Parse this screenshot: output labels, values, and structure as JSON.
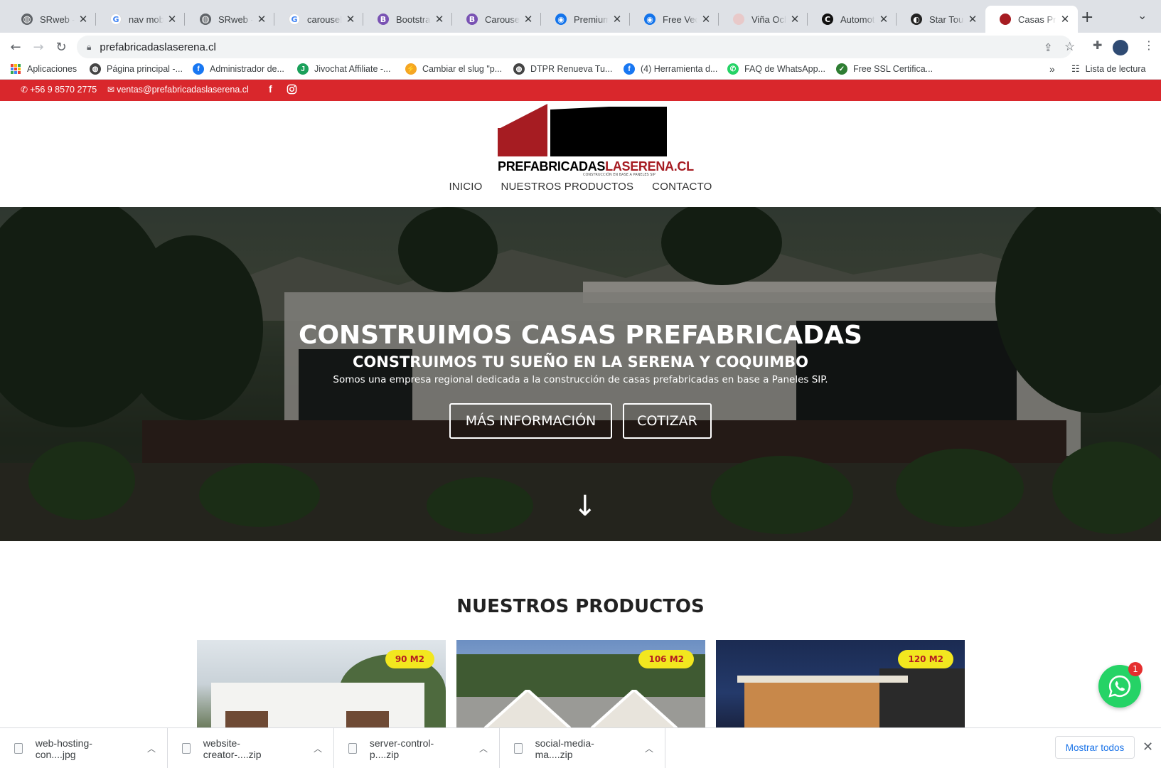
{
  "browser": {
    "tabs": [
      {
        "title": "SRweb - D",
        "favicon": "globe-icon",
        "color": "#5f6368",
        "glyph": ""
      },
      {
        "title": "nav mobile",
        "favicon": "google-icon",
        "color": "#ffffff",
        "glyph": "G"
      },
      {
        "title": "SRweb - D",
        "favicon": "globe-icon",
        "color": "#5f6368",
        "glyph": ""
      },
      {
        "title": "carousel lo",
        "favicon": "google-icon",
        "color": "#ffffff",
        "glyph": "G"
      },
      {
        "title": "Bootstrap",
        "favicon": "bootstrap-icon",
        "color": "#7952b3",
        "glyph": "B"
      },
      {
        "title": "Carousel -",
        "favicon": "bootstrap-icon",
        "color": "#7952b3",
        "glyph": "B"
      },
      {
        "title": "Premium P",
        "favicon": "freepik-icon",
        "color": "#1273eb",
        "glyph": "◉"
      },
      {
        "title": "Free Vecto",
        "favicon": "freepik-icon",
        "color": "#1273eb",
        "glyph": "◉"
      },
      {
        "title": "Viña Ocho",
        "favicon": "vina-icon",
        "color": "#e8c9c9",
        "glyph": ""
      },
      {
        "title": "Automotriz",
        "favicon": "c-icon",
        "color": "#111111",
        "glyph": "C"
      },
      {
        "title": "Star Tour -",
        "favicon": "startour-icon",
        "color": "#222222",
        "glyph": "◐"
      },
      {
        "title": "Casas Pref",
        "favicon": "prefab-icon",
        "color": "#a61c22",
        "glyph": "",
        "active": true
      }
    ],
    "url": "prefabricadaslaserena.cl",
    "bookmarks": [
      {
        "label": "Aplicaciones",
        "icon": "apps-grid-icon"
      },
      {
        "label": "Página principal -...",
        "icon": "globe-icon",
        "color": "#444444"
      },
      {
        "label": "Administrador de...",
        "icon": "facebook-icon",
        "color": "#1877f2",
        "glyph": "f"
      },
      {
        "label": "Jivochat Affiliate -...",
        "icon": "jivochat-icon",
        "color": "#1aa05a",
        "glyph": "J"
      },
      {
        "label": "Cambiar el slug \"p...",
        "icon": "bolt-icon",
        "color": "#f5a623",
        "glyph": "⚡"
      },
      {
        "label": "DTPR Renueva Tu...",
        "icon": "globe-icon",
        "color": "#444444"
      },
      {
        "label": "(4) Herramienta d...",
        "icon": "facebook-icon",
        "color": "#1877f2",
        "glyph": "f"
      },
      {
        "label": "FAQ de WhatsApp...",
        "icon": "whatsapp-icon",
        "color": "#25d366",
        "glyph": "✆"
      },
      {
        "label": "Free SSL Certifica...",
        "icon": "shield-icon",
        "color": "#2e7d32",
        "glyph": "✓"
      }
    ],
    "overflow": "»",
    "reading_list": "Lista de lectura"
  },
  "site": {
    "topbar": {
      "phone": "+56 9 8570 2775",
      "email": "ventas@prefabricadaslaserena.cl",
      "facebook": "f",
      "accent": "#d9272c"
    },
    "logo": {
      "prefix": "PREFABRICADAS",
      "suffix": "LASERENA.CL",
      "tagline": "CONSTRUCCIÓN EN BASE A PANELES SIP"
    },
    "menu": [
      "INICIO",
      "NUESTROS PRODUCTOS",
      "CONTACTO"
    ],
    "hero": {
      "title": "CONSTRUIMOS CASAS PREFABRICADAS",
      "subtitle": "CONSTRUIMOS TU SUEÑO EN LA SERENA Y COQUIMBO",
      "text": "Somos una empresa regional dedicada a la construcción de casas prefabricadas en base a Paneles SIP.",
      "btn_info": "MÁS INFORMACIÓN",
      "btn_quote": "COTIZAR",
      "arrow": "↓"
    },
    "products": {
      "title": "NUESTROS PRODUCTOS",
      "cards": [
        {
          "badge": "90 M2"
        },
        {
          "badge": "106 M2"
        },
        {
          "badge": "120 M2"
        }
      ]
    },
    "whatsapp": {
      "count": "1"
    }
  },
  "downloads": {
    "items": [
      {
        "name": "web-hosting-con....jpg"
      },
      {
        "name": "website-creator-....zip"
      },
      {
        "name": "server-control-p....zip"
      },
      {
        "name": "social-media-ma....zip"
      }
    ],
    "show_all": "Mostrar todos"
  }
}
